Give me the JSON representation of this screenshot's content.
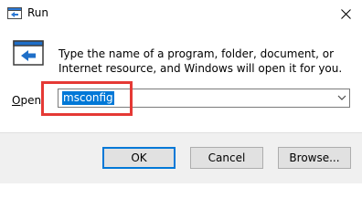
{
  "window": {
    "title": "Run",
    "icon": "run-app-icon"
  },
  "titlebar": {
    "close_icon": "close-icon"
  },
  "content": {
    "icon": "run-icon",
    "description": "Type the name of a program, folder, document, or Internet resource, and Windows will open it for you.",
    "open_label": "Open:",
    "open_access_key": "O",
    "open_value": "msconfig",
    "open_value_selected": true,
    "dropdown_icon": "chevron-down-icon",
    "highlight_color": "#e53935",
    "selection_color": "#0078d7"
  },
  "buttons": {
    "ok": "OK",
    "cancel": "Cancel",
    "browse": "Browse..."
  }
}
